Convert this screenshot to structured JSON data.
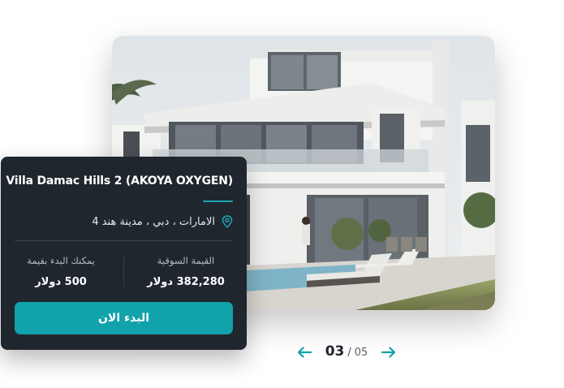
{
  "listing": {
    "title": "Villa Damac Hills 2 (AKOYA OXYGEN)",
    "location": "الامارات ، دبي ، مدينة هند 4",
    "market_value_label": "القيمة السوقية",
    "market_value": "382,280 دولار",
    "start_label": "يمكنك البدء بقيمة",
    "start_value": "500 دولار",
    "cta_label": "البدء الان"
  },
  "pager": {
    "current": "03",
    "separator": "/",
    "total": "05"
  },
  "colors": {
    "accent": "#11a2ab",
    "card_bg": "#20262e"
  },
  "icons": {
    "location": "map-pin-icon",
    "prev": "arrow-left-icon",
    "next": "arrow-right-icon"
  }
}
